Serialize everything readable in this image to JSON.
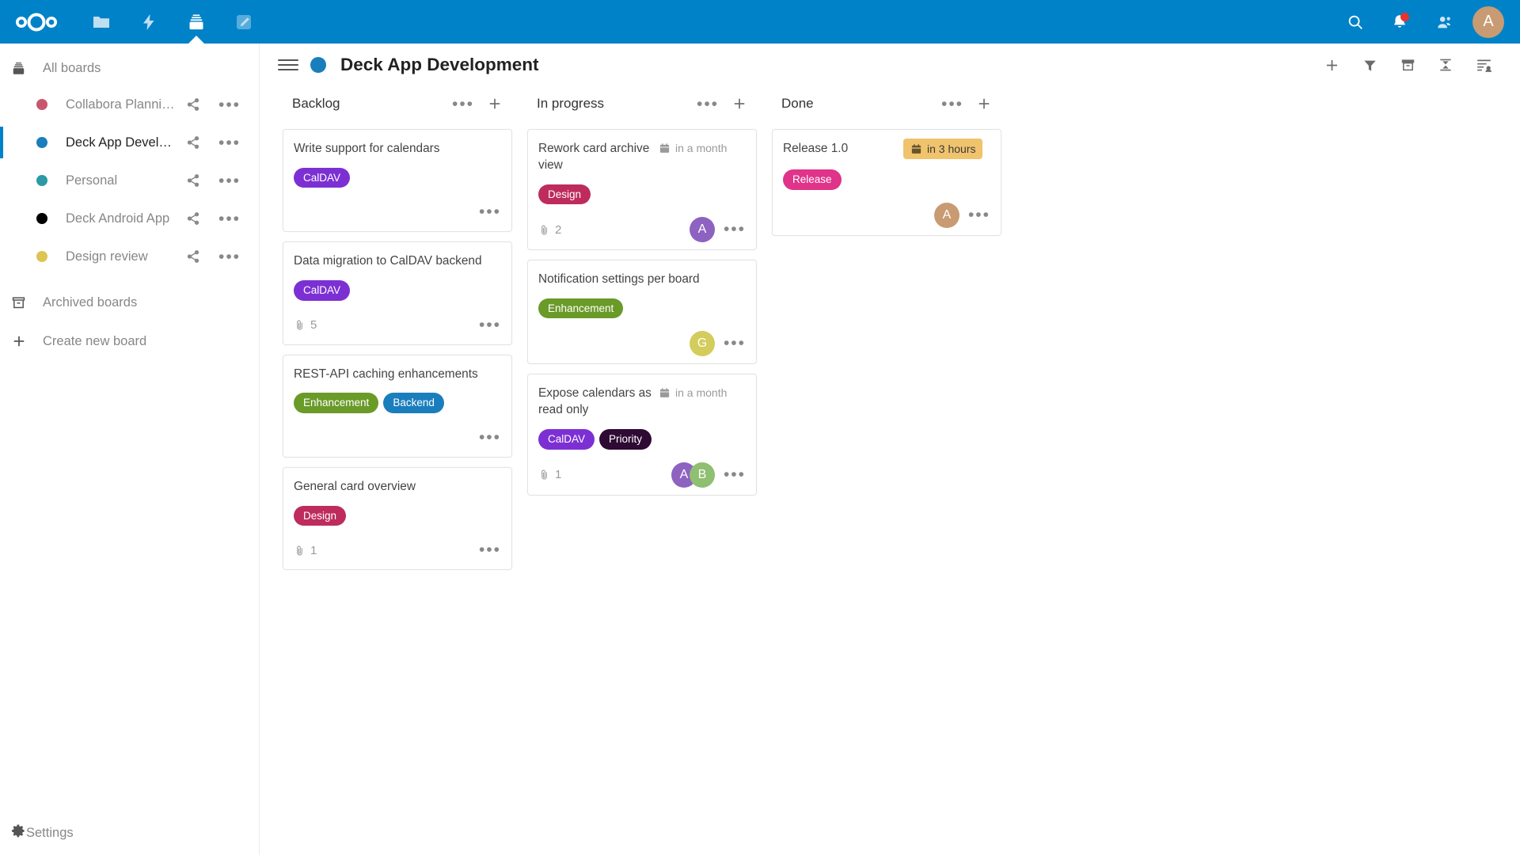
{
  "topbar": {
    "logo_name": "nextcloud-logo",
    "apps": [
      {
        "name": "files-app-icon",
        "label": "Files",
        "active": false
      },
      {
        "name": "activity-app-icon",
        "label": "Activity",
        "active": false
      },
      {
        "name": "deck-app-icon",
        "label": "Deck",
        "active": true
      },
      {
        "name": "text-app-icon",
        "label": "Text",
        "active": false
      }
    ],
    "search_icon": "search-icon",
    "notifications_icon": "bell-icon",
    "notifications_has_unread": true,
    "contacts_icon": "contacts-icon",
    "user_avatar_initial": "A",
    "user_avatar_color": "#c89b72",
    "background_color": "#0082c9"
  },
  "sidebar": {
    "all_boards": {
      "label": "All boards",
      "icon": "deck-stack-icon"
    },
    "boards": [
      {
        "label": "Collabora Planning",
        "color": "#c8576e",
        "active": false
      },
      {
        "label": "Deck App Develo...",
        "color": "#1a7ebd",
        "active": true
      },
      {
        "label": "Personal",
        "color": "#2b9aa5",
        "active": false
      },
      {
        "label": "Deck Android App",
        "color": "#000000",
        "active": false
      },
      {
        "label": "Design review",
        "color": "#ddc453",
        "active": false
      }
    ],
    "share_icon": "share-icon",
    "menu_icon": "more-options-icon",
    "archived_boards": {
      "label": "Archived boards",
      "icon": "archive-icon"
    },
    "create_new_board": {
      "label": "Create new board",
      "icon": "plus-icon"
    },
    "settings": {
      "label": "Settings",
      "icon": "gear-icon"
    }
  },
  "board": {
    "menu_icon": "hamburger-menu-icon",
    "color": "#1a7ebd",
    "title": "Deck App Development",
    "actions": [
      {
        "name": "add-card-button",
        "icon": "plus-icon"
      },
      {
        "name": "filter-button",
        "icon": "filter-icon"
      },
      {
        "name": "archived-cards-button",
        "icon": "archive-icon"
      },
      {
        "name": "collapse-button",
        "icon": "collapse-icon"
      },
      {
        "name": "board-details-button",
        "icon": "details-sidebar-icon"
      }
    ]
  },
  "columns": [
    {
      "title": "Backlog",
      "menu_icon": "more-options-icon",
      "add_icon": "plus-icon",
      "cards": [
        {
          "title": "Write support for calendars",
          "due": null,
          "labels": [
            {
              "text": "CalDAV",
              "color": "#7c30d4"
            }
          ],
          "attachments": null,
          "avatars": []
        },
        {
          "title": "Data migration to CalDAV backend",
          "due": null,
          "labels": [
            {
              "text": "CalDAV",
              "color": "#7c30d4"
            }
          ],
          "attachments": "5",
          "avatars": []
        },
        {
          "title": "REST-API caching enhancements",
          "due": null,
          "labels": [
            {
              "text": "Enhancement",
              "color": "#6a9a28"
            },
            {
              "text": "Backend",
              "color": "#1a7ebd"
            }
          ],
          "attachments": null,
          "avatars": []
        },
        {
          "title": "General card overview",
          "due": null,
          "labels": [
            {
              "text": "Design",
              "color": "#be2b5d"
            }
          ],
          "attachments": "1",
          "avatars": []
        }
      ]
    },
    {
      "title": "In progress",
      "menu_icon": "more-options-icon",
      "add_icon": "plus-icon",
      "cards": [
        {
          "title": "Rework card archive view",
          "due": {
            "text": "in a month",
            "highlight": false
          },
          "labels": [
            {
              "text": "Design",
              "color": "#be2b5d"
            }
          ],
          "attachments": "2",
          "avatars": [
            {
              "initial": "A",
              "color": "#8e62c1"
            }
          ]
        },
        {
          "title": "Notification settings per board",
          "due": null,
          "labels": [
            {
              "text": "Enhancement",
              "color": "#6a9a28"
            }
          ],
          "attachments": null,
          "avatars": [
            {
              "initial": "G",
              "color": "#d4cc5c"
            }
          ]
        },
        {
          "title": "Expose calendars as read only",
          "due": {
            "text": "in a month",
            "highlight": false
          },
          "labels": [
            {
              "text": "CalDAV",
              "color": "#7c30d4"
            },
            {
              "text": "Priority",
              "color": "#2d0b33"
            }
          ],
          "attachments": "1",
          "avatars": [
            {
              "initial": "A",
              "color": "#8e62c1"
            },
            {
              "initial": "B",
              "color": "#8fbf71"
            }
          ]
        }
      ]
    },
    {
      "title": "Done",
      "menu_icon": "more-options-icon",
      "add_icon": "plus-icon",
      "cards": [
        {
          "title": "Release 1.0",
          "due": {
            "text": "in 3 hours",
            "highlight": true
          },
          "labels": [
            {
              "text": "Release",
              "color": "#e0338a"
            }
          ],
          "attachments": null,
          "avatars": [
            {
              "initial": "A",
              "color": "#c89b72"
            }
          ]
        }
      ]
    }
  ]
}
